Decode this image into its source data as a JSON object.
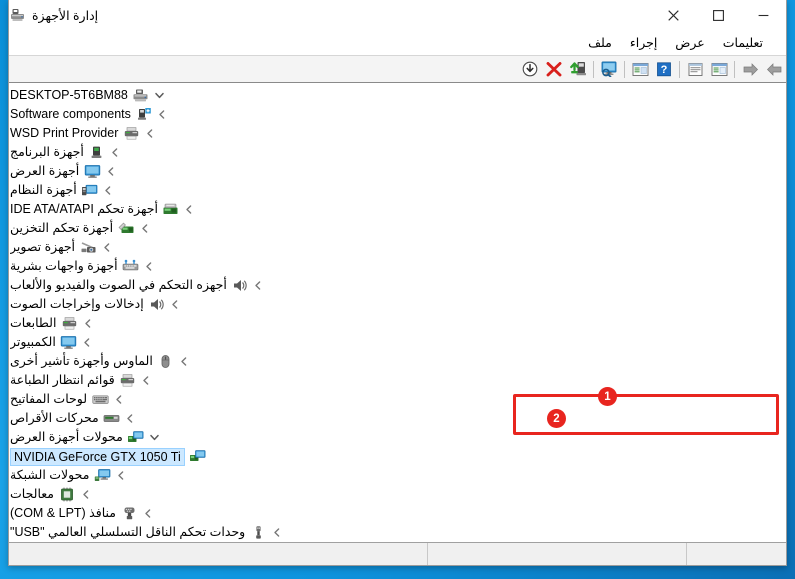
{
  "window": {
    "title": "إدارة الأجهزة",
    "app_icon": "device-manager-icon",
    "controls": {
      "close": "✕",
      "maximize": "❐",
      "minimize": "—"
    }
  },
  "menu": {
    "items": [
      {
        "label": "ملف",
        "name": "menu-file"
      },
      {
        "label": "إجراء",
        "name": "menu-action"
      },
      {
        "label": "عرض",
        "name": "menu-view"
      },
      {
        "label": "تعليمات",
        "name": "menu-help"
      }
    ]
  },
  "toolbar": {
    "buttons": [
      {
        "name": "forward-button",
        "icon": "arrow-right-icon",
        "title": "التالي"
      },
      {
        "name": "back-button",
        "icon": "arrow-left-icon",
        "title": "السابق"
      },
      {
        "name": "show-hidden-devices-button",
        "icon": "show-devices-icon",
        "title": "إظهار"
      },
      {
        "name": "properties-button",
        "icon": "properties-icon",
        "title": "خصائص"
      },
      {
        "name": "help-button",
        "icon": "help-question-icon",
        "title": "تعليمات"
      },
      {
        "name": "update-driver-button",
        "icon": "update-driver-icon",
        "title": "تحديث"
      },
      {
        "name": "scan-hardware-button",
        "icon": "scan-monitor-icon",
        "title": "فحص تغييرات الأجهزة"
      },
      {
        "name": "enable-device-button",
        "icon": "enable-device-icon",
        "title": "تمكين الجهاز"
      },
      {
        "name": "uninstall-device-button",
        "icon": "red-x-icon",
        "title": "إلغاء تثبيت الجهاز"
      },
      {
        "name": "download-button",
        "icon": "download-arrow-icon",
        "title": "تنزيل"
      }
    ]
  },
  "tree": {
    "root": {
      "label": "DESKTOP-5T6BM88",
      "icon": "computer-root-icon",
      "expanded": true,
      "chevron": "chevron-down-icon"
    },
    "items": [
      {
        "label": "Software components",
        "icon": "software-component-icon",
        "expanded": false,
        "chevron": "chevron-left-icon",
        "selected": false,
        "level": 1
      },
      {
        "label": "WSD Print Provider",
        "icon": "printer-icon",
        "expanded": false,
        "chevron": "chevron-left-icon",
        "selected": false,
        "level": 1
      },
      {
        "label": "أجهزة البرنامج",
        "icon": "software-device-icon",
        "expanded": false,
        "chevron": "chevron-left-icon",
        "selected": false,
        "level": 1
      },
      {
        "label": "أجهزة العرض",
        "icon": "monitor-icon",
        "expanded": false,
        "chevron": "chevron-left-icon",
        "selected": false,
        "level": 1
      },
      {
        "label": "أجهزة النظام",
        "icon": "system-device-icon",
        "expanded": false,
        "chevron": "chevron-left-icon",
        "selected": false,
        "level": 1
      },
      {
        "label": "أجهزة تحكم IDE ATA/ATAPI",
        "icon": "ide-controller-icon",
        "expanded": false,
        "chevron": "chevron-left-icon",
        "selected": false,
        "level": 1
      },
      {
        "label": "أجهزة تحكم التخزين",
        "icon": "storage-controller-icon",
        "expanded": false,
        "chevron": "chevron-left-icon",
        "selected": false,
        "level": 1
      },
      {
        "label": "أجهزة تصوير",
        "icon": "camera-icon",
        "expanded": false,
        "chevron": "chevron-left-icon",
        "selected": false,
        "level": 1
      },
      {
        "label": "أجهزة واجهات بشرية",
        "icon": "hid-icon",
        "expanded": false,
        "chevron": "chevron-left-icon",
        "selected": false,
        "level": 1
      },
      {
        "label": "أجهزه التحكم في الصوت والفيديو والألعاب",
        "icon": "speaker-icon",
        "expanded": false,
        "chevron": "chevron-left-icon",
        "selected": false,
        "level": 1
      },
      {
        "label": "إدخالات وإخراجات الصوت",
        "icon": "speaker-icon",
        "expanded": false,
        "chevron": "chevron-left-icon",
        "selected": false,
        "level": 1
      },
      {
        "label": "الطابعات",
        "icon": "printer-icon",
        "expanded": false,
        "chevron": "chevron-left-icon",
        "selected": false,
        "level": 1
      },
      {
        "label": "الكمبيوتر",
        "icon": "monitor-icon",
        "expanded": false,
        "chevron": "chevron-left-icon",
        "selected": false,
        "level": 1
      },
      {
        "label": "الماوس وأجهزة تأشير أخرى",
        "icon": "mouse-icon",
        "expanded": false,
        "chevron": "chevron-left-icon",
        "selected": false,
        "level": 1
      },
      {
        "label": "قوائم انتظار الطباعة",
        "icon": "printer-icon",
        "expanded": false,
        "chevron": "chevron-left-icon",
        "selected": false,
        "level": 1
      },
      {
        "label": "لوحات المفاتيح",
        "icon": "keyboard-icon",
        "expanded": false,
        "chevron": "chevron-left-icon",
        "selected": false,
        "level": 1
      },
      {
        "label": "محركات الأقراص",
        "icon": "disk-drive-icon",
        "expanded": false,
        "chevron": "chevron-left-icon",
        "selected": false,
        "level": 1
      },
      {
        "label": "محولات أجهزة العرض",
        "icon": "display-adapter-icon",
        "expanded": true,
        "chevron": "chevron-down-icon",
        "selected": false,
        "level": 1
      },
      {
        "label": "NVIDIA GeForce GTX 1050 Ti",
        "icon": "display-adapter-icon",
        "expanded": false,
        "chevron": "none",
        "selected": true,
        "level": 2
      },
      {
        "label": "محولات الشبكة",
        "icon": "network-adapter-icon",
        "expanded": false,
        "chevron": "chevron-left-icon",
        "selected": false,
        "level": 1
      },
      {
        "label": "معالجات",
        "icon": "processor-icon",
        "expanded": false,
        "chevron": "chevron-left-icon",
        "selected": false,
        "level": 1
      },
      {
        "label": "منافذ (COM & LPT)",
        "icon": "port-icon",
        "expanded": false,
        "chevron": "chevron-left-icon",
        "selected": false,
        "level": 1
      },
      {
        "label": "وحدات تحكم الناقل التسلسلي العالمي \"USB\"",
        "icon": "usb-icon",
        "expanded": false,
        "chevron": "chevron-left-icon",
        "selected": false,
        "level": 1
      }
    ]
  },
  "annotations": {
    "accent_color": "#e8251f",
    "badges": [
      {
        "number": "1",
        "name": "annotation-badge-1"
      },
      {
        "number": "2",
        "name": "annotation-badge-2"
      }
    ]
  },
  "statusbar": {
    "cells": [
      "",
      "",
      ""
    ]
  }
}
